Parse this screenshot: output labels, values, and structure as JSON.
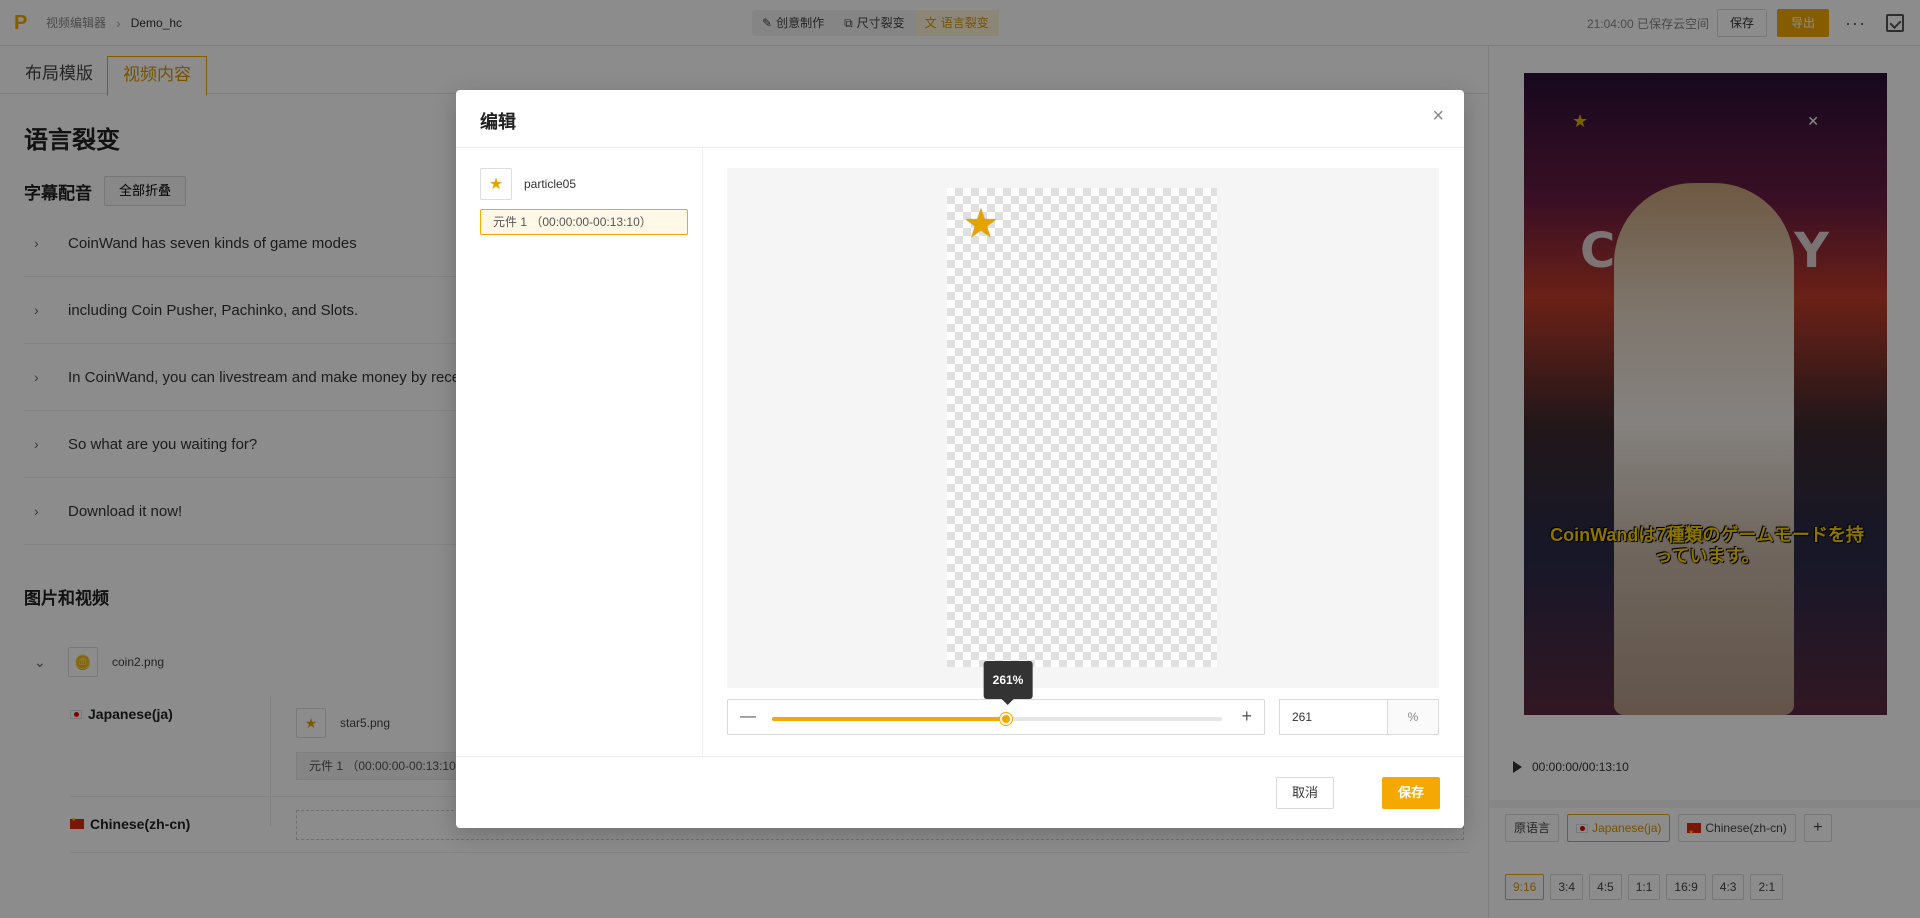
{
  "topbar": {
    "logo": "P",
    "breadcrumb": [
      "视频编辑器",
      "Demo_hc"
    ],
    "modes": [
      {
        "label": "创意制作",
        "icon": "magic-icon",
        "active": false
      },
      {
        "label": "尺寸裂变",
        "icon": "resize-icon",
        "active": false
      },
      {
        "label": "语言裂变",
        "icon": "translate-icon",
        "active": true
      }
    ],
    "autosave": "21:04:00 已保存云空间",
    "save_label": "保存",
    "export_label": "导出",
    "more": "···"
  },
  "left": {
    "tabs": [
      "布局模版",
      "视频内容"
    ],
    "section_title": "语言裂变",
    "subtitle_title": "字幕配音",
    "fold_all": "全部折叠",
    "subtitles": [
      "CoinWand has seven kinds of game modes",
      "including Coin Pusher, Pachinko, and Slots.",
      "In CoinWand, you can livestream and make money by rece",
      "So what are you waiting for?",
      "Download it now!"
    ],
    "media_title": "图片和视频",
    "media": {
      "name": "coin2.png"
    },
    "languages": [
      {
        "name": "Japanese(ja)",
        "file": "star5.png",
        "element": "元件 1 （00:00:00-00:13:10"
      },
      {
        "name": "Chinese(zh-cn)"
      }
    ]
  },
  "preview": {
    "caption": "CoinWandは7種類のゲームモードを持っています。",
    "background_text": "CASH GY",
    "time": "00:00:00/00:13:10",
    "lang_chips": [
      "原语言",
      "Japanese(ja)",
      "Chinese(zh-cn)"
    ],
    "add": "+",
    "ratios": [
      "9:16",
      "3:4",
      "4:5",
      "1:1",
      "16:9",
      "4:3",
      "2:1"
    ],
    "active_ratio": "9:16"
  },
  "modal": {
    "title": "编辑",
    "close": "×",
    "item_name": "particle05",
    "element": "元件 1 （00:00:00-00:13:10）",
    "zoom": {
      "value": 261,
      "tooltip": "261%",
      "unit": "%",
      "position": 0.52
    },
    "cancel": "取消",
    "save": "保存"
  },
  "colors": {
    "accent": "#f5a800",
    "overlay": "rgba(0,0,0,0.45)"
  }
}
